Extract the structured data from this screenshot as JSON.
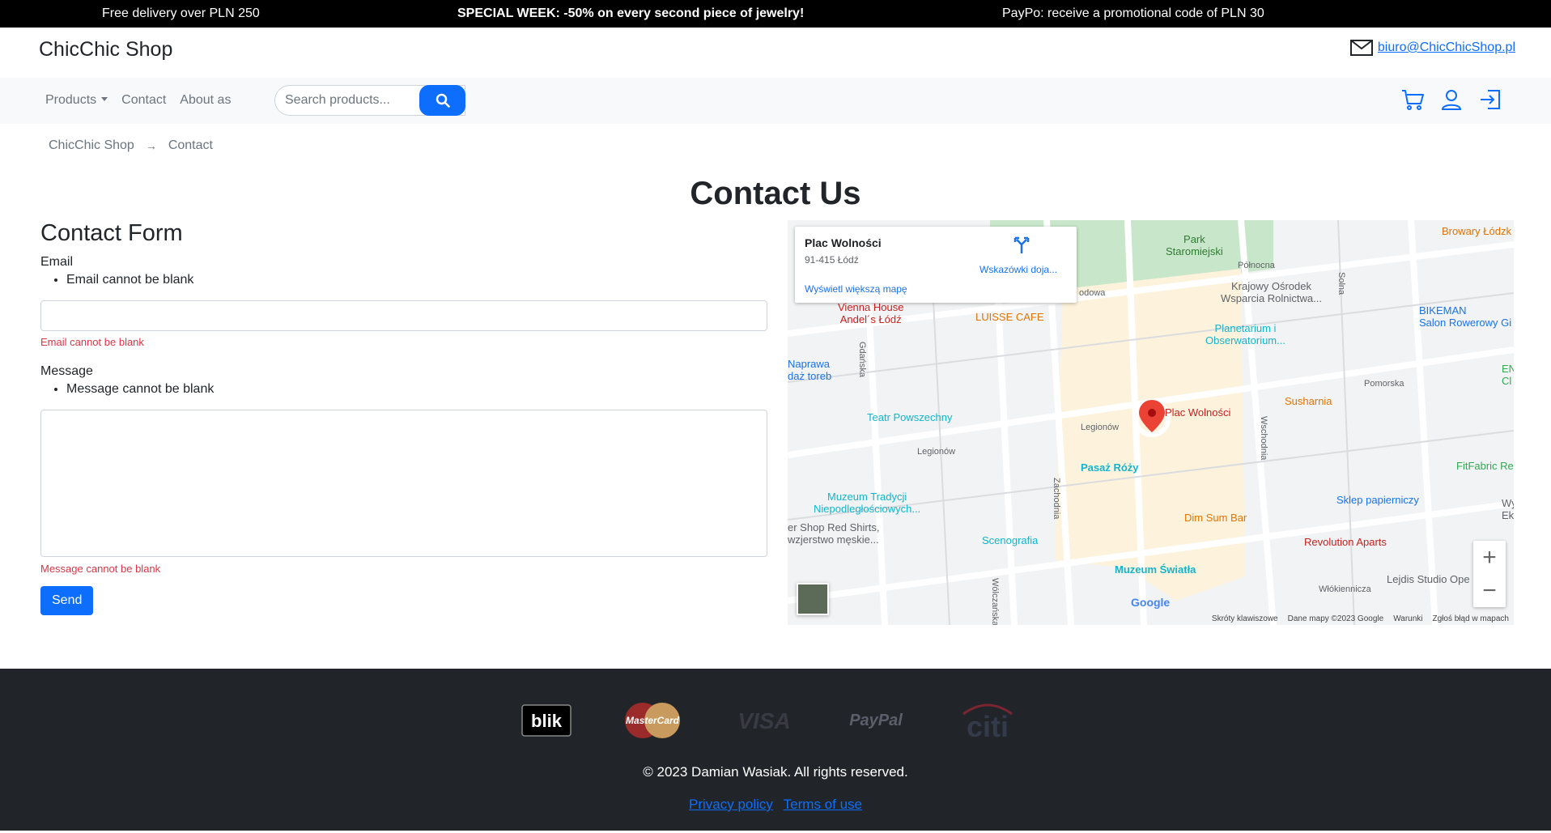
{
  "promo": {
    "left": "Free delivery over PLN 250",
    "center": "SPECIAL WEEK: -50% on every second piece of jewelry!",
    "right": "PayPo: receive a promotional code of PLN 30"
  },
  "header": {
    "brand": "ChicChic Shop",
    "email": "biuro@ChicChicShop.pl",
    "email_icon": "envelope-icon"
  },
  "nav": {
    "products": "Products",
    "contact": "Contact",
    "about": "About as",
    "search_placeholder": "Search products...",
    "icons": [
      "search-icon",
      "cart-icon",
      "user-icon",
      "login-icon"
    ]
  },
  "breadcrumb": {
    "home": "ChicChic Shop",
    "separator": "→",
    "current": "Contact"
  },
  "page_title": "Contact Us",
  "form": {
    "title": "Contact Form",
    "email_label": "Email",
    "email_error_list": "Email cannot be blank",
    "email_value": "",
    "email_error": "Email cannot be blank",
    "message_label": "Message",
    "message_error_list": "Message cannot be blank",
    "message_value": "",
    "message_error": "Message cannot be blank",
    "send_label": "Send"
  },
  "map": {
    "place_title": "Plac Wolności",
    "place_address": "91-415 Łódź",
    "directions": "Wskazówki doja...",
    "larger_map": "Wyświetl większą mapę",
    "zoom_in": "+",
    "zoom_out": "−",
    "google": "Google",
    "footer_items": [
      "Skróty klawiszowe",
      "Dane mapy ©2023 Google",
      "Warunki",
      "Zgłoś błąd w mapach"
    ],
    "labels": {
      "park": "Park\nStaromiejski",
      "browary": "Browary Łódzk",
      "polnocna": "Północna",
      "krajowy": "Krajowy Ośrodek\nWsparcia Rolnictwa...",
      "bikeman": "BIKEMAN\nSalon Rowerowy Gi",
      "vienna": "Vienna House\nAndel´s Łódź",
      "luisse": "LUISSE CAFE",
      "planetarium": "Planetarium i\nObserwatorium...",
      "naprawa": "Naprawa\ndaż toreb",
      "pomorska": "Pomorska",
      "susharnia": "Susharnia",
      "plac": "Plac Wolności",
      "teatr": "Teatr Powszechny",
      "legionow1": "Legionów",
      "legionow2": "Legionów",
      "pasaz": "Pasaż Róży",
      "fitfabric": "FitFabric Re",
      "muzeum_tradycji": "Muzeum Tradycji\nNiepodległościowych...",
      "sklep": "Sklep papierniczy",
      "dim_sum": "Dim Sum Bar",
      "red_shirts": "er Shop Red Shirts,\nwzjerstwo męskie...",
      "revolution": "Revolution Aparts",
      "scenografia": "Scenografia",
      "muzeum_swiatla": "Muzeum Światła",
      "lejdis": "Lejdis Studio Ope",
      "wlokiennicza": "Włókiennicza",
      "gdanska": "Gdańska",
      "zachodnia": "Zachodnia",
      "wschodnia": "Wschodnia",
      "wolczanska": "Wólczańska",
      "solna": "Solna",
      "zgodowa": "odowa",
      "en": "EN\nCl",
      "wy": "Wy\nEk"
    }
  },
  "footer": {
    "payments": [
      "blik",
      "MasterCard",
      "VISA",
      "PayPal",
      "citi"
    ],
    "copyright": "© 2023 Damian Wasiak. All rights reserved.",
    "privacy": "Privacy policy",
    "terms": "Terms of use"
  }
}
